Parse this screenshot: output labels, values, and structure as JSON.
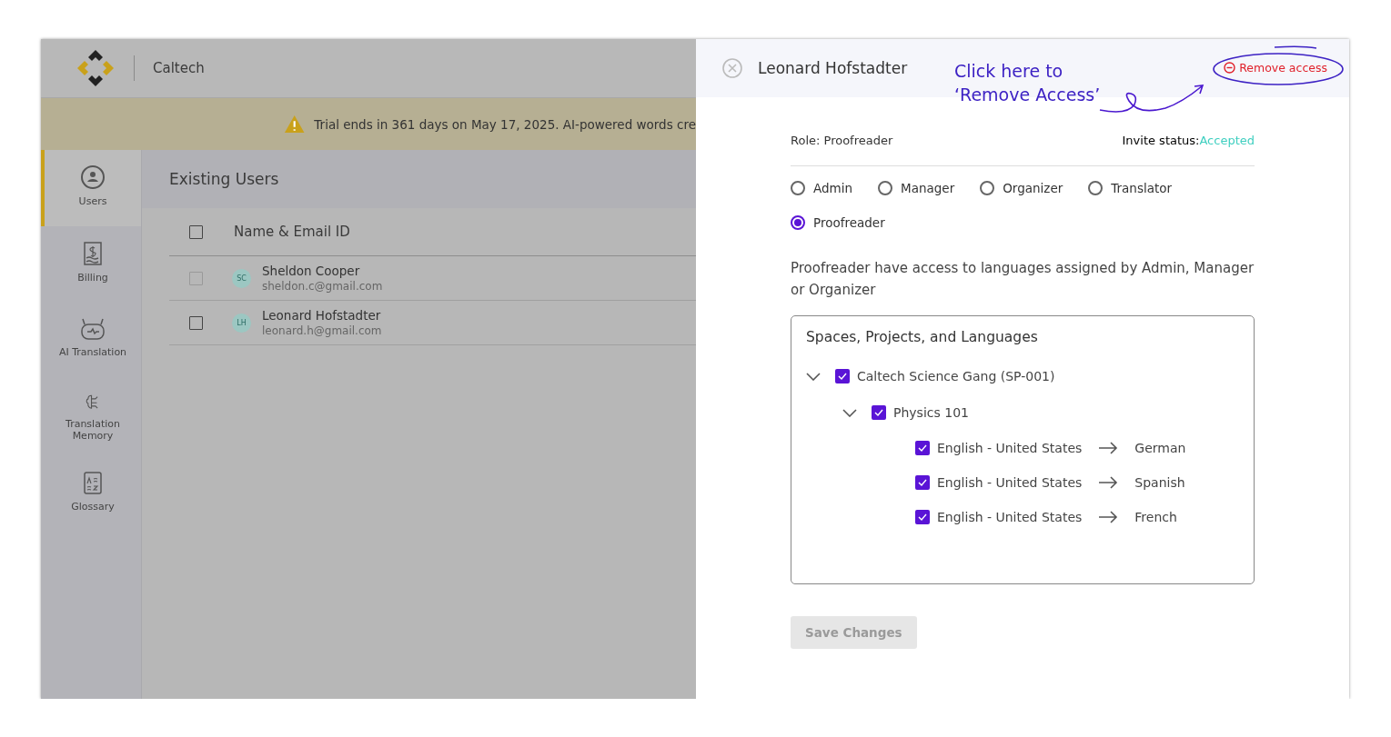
{
  "header": {
    "org": "Caltech"
  },
  "banner": {
    "text": "Trial ends in 361 days on May 17, 2025. AI-powered words cre"
  },
  "sidebar": {
    "items": [
      {
        "label": "Users",
        "selected": true
      },
      {
        "label": "Billing",
        "selected": false
      },
      {
        "label": "AI Translation",
        "selected": false
      },
      {
        "label": "Translation Memory",
        "selected": false
      },
      {
        "label": "Glossary",
        "selected": false
      }
    ]
  },
  "users": {
    "title": "Existing Users",
    "column": "Name & Email ID",
    "all_checked": false,
    "rows": [
      {
        "initials": "SC",
        "name": "Sheldon Cooper",
        "email": "sheldon.c@gmail.com",
        "checked": false,
        "disabled": true
      },
      {
        "initials": "LH",
        "name": "Leonard Hofstadter",
        "email": "leonard.h@gmail.com",
        "checked": false,
        "disabled": false
      }
    ]
  },
  "drawer": {
    "title": "Leonard Hofstadter",
    "remove_label": "Remove access",
    "annotation": [
      "Click here to",
      "‘Remove Access’"
    ],
    "role_text": "Role: Proofreader",
    "invite_label": "Invite status:",
    "invite_value": "Accepted",
    "roles": [
      {
        "label": "Admin",
        "selected": false
      },
      {
        "label": "Manager",
        "selected": false
      },
      {
        "label": "Organizer",
        "selected": false
      },
      {
        "label": "Translator",
        "selected": false
      },
      {
        "label": "Proofreader",
        "selected": true
      }
    ],
    "description": "Proofreader have access to languages assigned by Admin, Manager or Organizer",
    "tree": {
      "title": "Spaces, Projects, and Languages",
      "items": [
        {
          "kind": "group",
          "label": "Caltech Science Gang (SP-001)",
          "checked": true,
          "expanded": true,
          "children": [
            {
              "kind": "group",
              "label": "Physics 101",
              "checked": true,
              "expanded": true,
              "children": [
                {
                  "kind": "pair",
                  "source": "English - United States",
                  "target": "German",
                  "checked": true
                },
                {
                  "kind": "pair",
                  "source": "English - United States",
                  "target": "Spanish",
                  "checked": true
                },
                {
                  "kind": "pair",
                  "source": "English - United States",
                  "target": "French",
                  "checked": true
                }
              ]
            }
          ]
        }
      ]
    },
    "save": {
      "label": "Save Changes",
      "disabled": true
    }
  }
}
